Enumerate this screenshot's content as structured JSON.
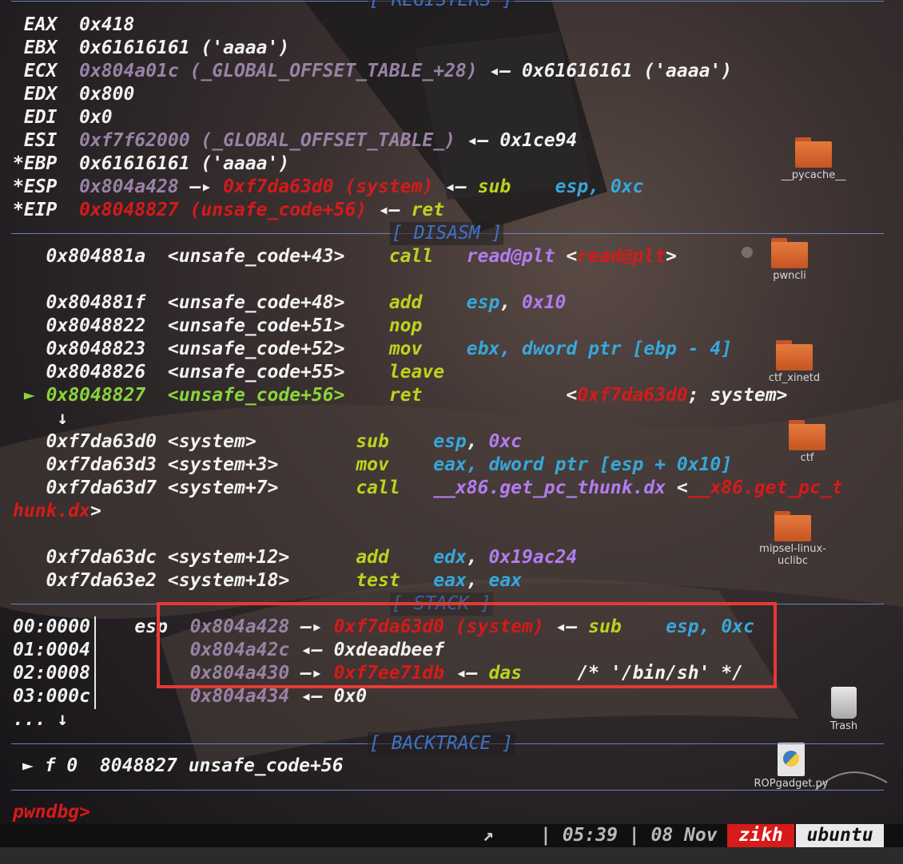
{
  "registers_header": "[ REGISTERS ]",
  "registers": [
    {
      "mark": " ",
      "name": "EAX",
      "value": "0x418",
      "rest": ""
    },
    {
      "mark": " ",
      "name": "EBX",
      "value": "0x61616161 ('aaaa')",
      "rest": ""
    },
    {
      "mark": " ",
      "name": "ECX",
      "value": "0x804a01c (_GLOBAL_OFFSET_TABLE_+28)",
      "arrow": "◂—",
      "target": "0x61616161 ('aaaa')"
    },
    {
      "mark": " ",
      "name": "EDX",
      "value": "0x800"
    },
    {
      "mark": " ",
      "name": "EDI",
      "value": "0x0"
    },
    {
      "mark": " ",
      "name": "ESI",
      "value": "0xf7f62000 (_GLOBAL_OFFSET_TABLE_)",
      "arrow": "◂—",
      "target": "0x1ce94"
    },
    {
      "mark": "*",
      "name": "EBP",
      "value": "0x61616161 ('aaaa')"
    },
    {
      "mark": "*",
      "name": "ESP",
      "value": "0x804a428",
      "arrow": "—▸",
      "target": "0xf7da63d0 (system)",
      "arrow2": "◂—",
      "mnem": "sub",
      "ops": "esp, 0xc"
    },
    {
      "mark": "*",
      "name": "EIP",
      "value": "0x8048827 (unsafe_code+56)",
      "arrow": "◂—",
      "mnem": "ret"
    }
  ],
  "disasm_header": "[ DISASM ]",
  "disasm": [
    {
      "addr": "0x804881a",
      "sym": "<unsafe_code+43>",
      "mnem": "call",
      "op1": "read@plt",
      "extra_open": "<",
      "extra_red": "read@plt",
      "extra_close": ">"
    },
    {
      "addr": "0x804881f",
      "sym": "<unsafe_code+48>",
      "mnem": "add",
      "op1": "esp",
      "op2": "0x10"
    },
    {
      "addr": "0x8048822",
      "sym": "<unsafe_code+51>",
      "mnem": "nop"
    },
    {
      "addr": "0x8048823",
      "sym": "<unsafe_code+52>",
      "mnem": "mov",
      "text": "ebx, dword ptr [ebp - 4]"
    },
    {
      "addr": "0x8048826",
      "sym": "<unsafe_code+55>",
      "mnem": "leave"
    },
    {
      "addr": "0x8048827",
      "sym": "<unsafe_code+56>",
      "mnem": "ret",
      "marker": "►",
      "target_red": "0xf7da63d0",
      "target_rest": "; system>"
    },
    {
      "addr": "0xf7da63d0",
      "sym": "<system>",
      "mnem": "sub",
      "op1": "esp",
      "op2": "0xc"
    },
    {
      "addr": "0xf7da63d3",
      "sym": "<system+3>",
      "mnem": "mov",
      "text": "eax, dword ptr [esp + 0x10]"
    },
    {
      "addr": "0xf7da63d7",
      "sym": "<system+7>",
      "mnem": "call",
      "op1": "__x86.get_pc_thunk.dx",
      "wrap_a": "__x86.get_pc_t",
      "wrap_b": "hunk.dx"
    },
    {
      "addr": "0xf7da63dc",
      "sym": "<system+12>",
      "mnem": "add",
      "op1": "edx",
      "op2": "0x19ac24"
    },
    {
      "addr": "0xf7da63e2",
      "sym": "<system+18>",
      "mnem": "test",
      "op1": "eax",
      "op2": "eax"
    }
  ],
  "down_arrow": "↓",
  "stack_header": "[ STACK ]",
  "stack": [
    {
      "idx": "00:0000",
      "reg": "esp",
      "addr": "0x804a428",
      "arrow": "—▸",
      "val": "0xf7da63d0 (system)",
      "arrow2": "◂—",
      "mnem": "sub",
      "ops": "esp, 0xc"
    },
    {
      "idx": "01:0004",
      "reg": "",
      "addr": "0x804a42c",
      "arrow": "◂—",
      "val": "0xdeadbeef"
    },
    {
      "idx": "02:0008",
      "reg": "",
      "addr": "0x804a430",
      "arrow": "—▸",
      "val": "0xf7ee71db",
      "arrow2": "◂—",
      "mnem": "das",
      "comment": "/* '/bin/sh' */"
    },
    {
      "idx": "03:000c",
      "reg": "",
      "addr": "0x804a434",
      "arrow": "◂—",
      "val": "0x0"
    }
  ],
  "stack_more": "... ↓",
  "backtrace_header": "[ BACKTRACE ]",
  "backtrace": "► f 0  8048827 unsafe_code+56",
  "prompt": "pwndbg>",
  "status": {
    "arrow": "↗",
    "time": "| 05:39 | 08 Nov",
    "user": "zikh",
    "host": "ubuntu"
  },
  "desktop_icons": [
    "__pycache__",
    "pwncli",
    "ctf_xinetd",
    "ctf",
    "mipsel-linux-uclibc",
    "Trash",
    "ROPgadget.py"
  ],
  "colors": {
    "red": "#d61a1a",
    "yellow": "#bdd21f",
    "cyan": "#36a8dc",
    "violet": "#b37cf0",
    "green": "#8ad63a",
    "header": "#3d73c4",
    "highlight_box": "#e53935"
  }
}
